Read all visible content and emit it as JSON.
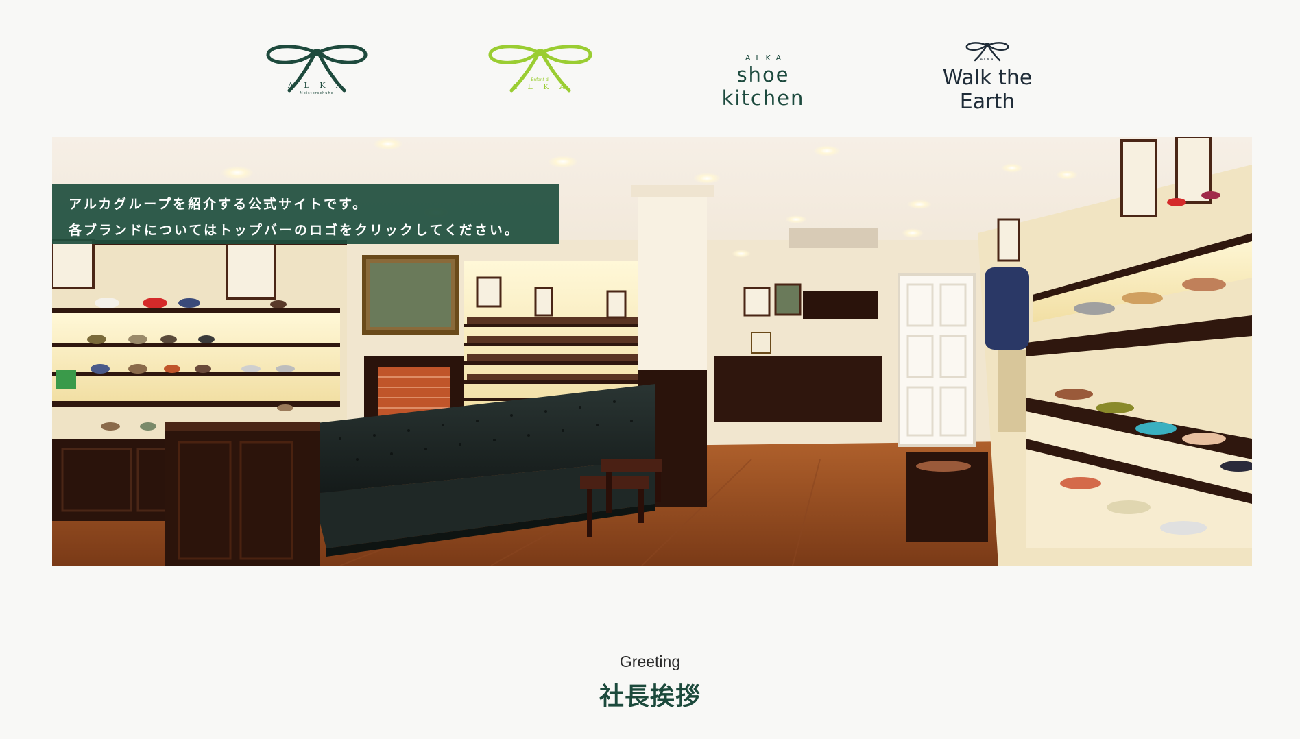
{
  "header": {
    "logos": [
      {
        "name": "ALKA Meisterschuhe",
        "wordmark": "A L K A",
        "sub": "Meisterschuhe",
        "color": "#1e4a3d",
        "icon": "ribbon-bow-icon"
      },
      {
        "name": "Enfant d' ALKA",
        "wordmark": "A L K A",
        "sub": "Enfant d'",
        "color": "#9acd32",
        "icon": "ribbon-bow-icon"
      },
      {
        "name": "ALKA shoe kitchen",
        "sub": "ALKA",
        "wordmark": "shoe kitchen",
        "color": "#1d4a3e"
      },
      {
        "name": "Walk the Earth",
        "wordmark": "Walk the Earth",
        "sub": "ALKA",
        "color": "#1f2c38",
        "icon": "ribbon-bow-icon"
      }
    ]
  },
  "hero": {
    "caption_line1": "アルカグループを紹介する公式サイトです。",
    "caption_line2": "各ブランドについてはトップバーのロゴをクリックしてください。",
    "caption_bg": "#1e4e3e"
  },
  "greeting": {
    "en": "Greeting",
    "ja": "社長挨拶",
    "ja_color": "#1c4a3c"
  }
}
